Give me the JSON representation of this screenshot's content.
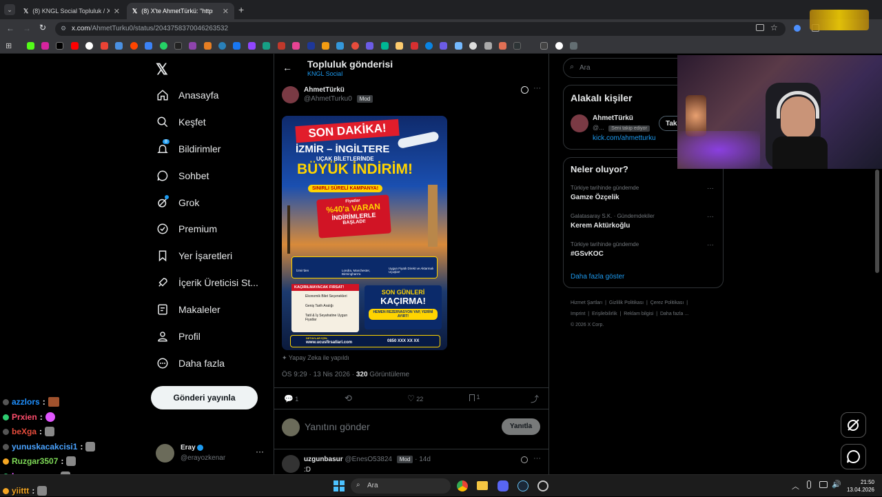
{
  "browser": {
    "tabs": [
      {
        "label": "(8) KNGL Social Topluluk / X"
      },
      {
        "label": "(8) X'te AhmetTürkü: \"https://t.c"
      }
    ],
    "url_host": "x.com",
    "url_path": "/AhmetTurku0/status/2043758370046263532"
  },
  "nav": {
    "items": [
      {
        "label": "Anasayfa",
        "icon": "home-icon"
      },
      {
        "label": "Keşfet",
        "icon": "search-icon"
      },
      {
        "label": "Bildirimler",
        "icon": "bell-icon"
      },
      {
        "label": "Sohbet",
        "icon": "chat-icon"
      },
      {
        "label": "Grok",
        "icon": "grok-icon"
      },
      {
        "label": "Premium",
        "icon": "premium-icon"
      },
      {
        "label": "Yer İşaretleri",
        "icon": "bookmark-icon"
      },
      {
        "label": "İçerik Üreticisi St...",
        "icon": "rocket-icon"
      },
      {
        "label": "Makaleler",
        "icon": "article-icon"
      },
      {
        "label": "Profil",
        "icon": "profile-icon"
      },
      {
        "label": "Daha fazla",
        "icon": "more-icon"
      }
    ],
    "notification_count": "8",
    "post_button": "Gönderi yayınla",
    "account": {
      "name": "Eray",
      "handle": "@erayozkenar"
    }
  },
  "header": {
    "title": "Topluluk gönderisi",
    "subtitle": "KNGL Social"
  },
  "post": {
    "author": "AhmetTürkü",
    "handle": "@AhmetTurku0",
    "badge": "Mod",
    "ai_note": "Yapay Zeka ile yapıldı",
    "time": "ÖS 9:29 · 13 Nis 2026 · ",
    "views_count": "320",
    "views_label": " Görüntüleme",
    "replies": "1",
    "likes": "22",
    "bookmarks": "1",
    "reply_placeholder": "Yanıtını gönder",
    "reply_button": "Yanıtla",
    "image": {
      "headline": "SON DAKİKA!",
      "route": "İZMİR – İNGİLTERE",
      "sub": "UÇAK BİLETLERİNDE",
      "big": "BÜYÜK İNDİRİM!",
      "campaign": "SINIRLI SÜRELİ KAMPANYA!",
      "discount_top": "Fiyatlar",
      "discount": "%40'a VARAN",
      "discount_mid": "İNDİRİMLERLE",
      "discount_bottom": "BAŞLADI!",
      "info1": "İzmir'den",
      "info2": "Londra, Manchester, Birmingham'a",
      "info3": "Uygun Fiyatlı Direkt ve Aktarmalı Uçuşlar!",
      "firsat": "KAÇIRILMAYACAK FIRSAT!",
      "list": [
        "Ekonomik Bilet Seçenekleri",
        "Geniş Tarih Aralığı",
        "Tatil & İş Seyahatine Uygun Fiyatlar"
      ],
      "last_days": "SON GÜNLERİ",
      "dont_miss": "KAÇIRMA!",
      "reserve": "HEMEN REZERVASYON YAP, YERİNİ AYIRT!",
      "details_label": "DETAYLAR İÇİN:",
      "website": "www.ucusfirsatlari.com",
      "phone": "0850 XXX XX XX"
    }
  },
  "reply": {
    "author": "uzgunbasur",
    "handle": "@EnesO53824",
    "badge": "Mod",
    "time": "· 14d",
    "text": ":D"
  },
  "sidebar": {
    "search_placeholder": "Ara",
    "related_title": "Alakalı kişiler",
    "related": {
      "name": "AhmetTürkü",
      "handle": "@...",
      "follows_you": "Seni takip ediyor",
      "button": "Tak",
      "link": "kick.com/ahmetturku"
    },
    "trends_title": "Neler oluyor?",
    "trends": [
      {
        "context": "Türkiye tarihinde gündemde",
        "name": "Gamze Özçelik"
      },
      {
        "context": "Galatasaray S.K. · Gündemdekiler",
        "name": "Kerem Aktürkoğlu"
      },
      {
        "context": "Türkiye tarihinde gündemde",
        "name": "#GSvKOC"
      }
    ],
    "show_more": "Daha fazla göster",
    "footer1": [
      "Hizmet Şartları",
      "Gizlilik Politikası",
      "Çerez Politikası"
    ],
    "footer2": [
      "Imprint",
      "Erişilebilirlik",
      "Reklam bilgisi",
      "Daha fazla ..."
    ],
    "copyright": "© 2026 X Corp."
  },
  "chat": [
    {
      "user": "azzlors",
      "color": "#1e90ff"
    },
    {
      "user": "Prxien",
      "color": "#ff4d6d"
    },
    {
      "user": "beXga",
      "color": "#e74c3c"
    },
    {
      "user": "yunuskacakcisi1",
      "color": "#4aa3ff"
    },
    {
      "user": "Ruzgar3507",
      "color": "#7ed957"
    },
    {
      "user": "kaanavsar",
      "color": "#e056fd"
    },
    {
      "user": "yiittt",
      "color": "#f5a623"
    }
  ],
  "taskbar": {
    "search": "Ara",
    "time": "21:50",
    "date": "13.04.2026"
  }
}
